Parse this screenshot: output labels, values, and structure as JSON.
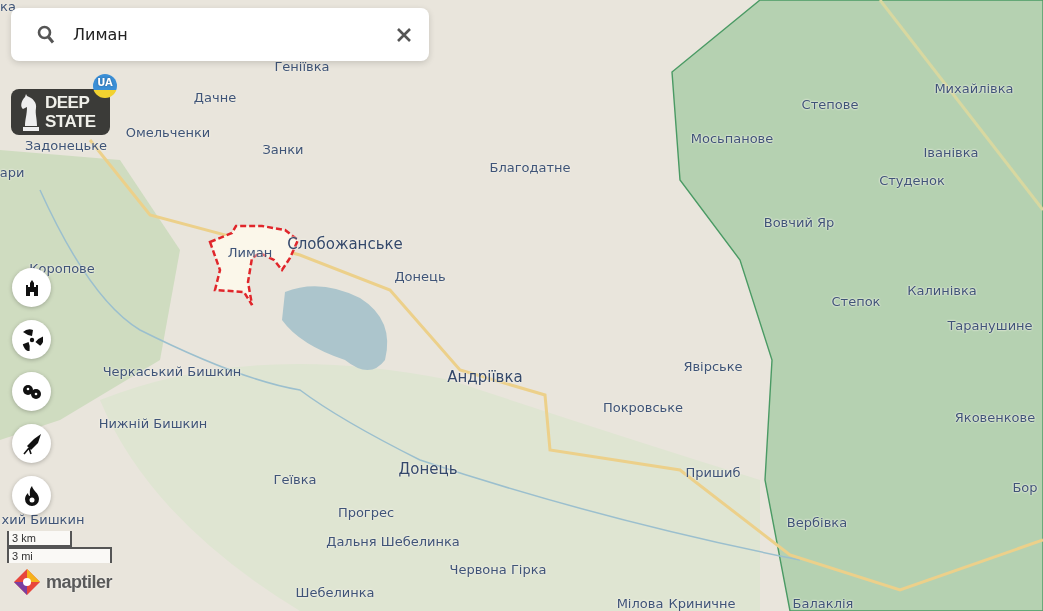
{
  "search": {
    "value": "Лиман"
  },
  "logo": {
    "line1": "DEEP",
    "line2": "STATE",
    "badge": "UA"
  },
  "tools": [
    {
      "kind": "castle"
    },
    {
      "kind": "radiation"
    },
    {
      "kind": "germs"
    },
    {
      "kind": "rocket"
    },
    {
      "kind": "fire"
    }
  ],
  "places": [
    {
      "name": "ка",
      "kind": "village"
    },
    {
      "name": "Геніївка",
      "kind": "village"
    },
    {
      "name": "Дачне",
      "kind": "village"
    },
    {
      "name": "Задонецьке",
      "kind": "village"
    },
    {
      "name": "Омельченки",
      "kind": "village"
    },
    {
      "name": "Занки",
      "kind": "village"
    },
    {
      "name": "ари",
      "kind": "village"
    },
    {
      "name": "Благодатне",
      "kind": "village"
    },
    {
      "name": "Мосьпанове",
      "kind": "village"
    },
    {
      "name": "Степове",
      "kind": "village"
    },
    {
      "name": "Михайлівка",
      "kind": "village"
    },
    {
      "name": "Іванівка",
      "kind": "village"
    },
    {
      "name": "Студенок",
      "kind": "village"
    },
    {
      "name": "Вовчий Яр",
      "kind": "village"
    },
    {
      "name": "Лиман",
      "kind": "village"
    },
    {
      "name": "Слобожанське",
      "kind": "town"
    },
    {
      "name": "Донець",
      "kind": "village"
    },
    {
      "name": "Коропове",
      "kind": "village"
    },
    {
      "name": "Степок",
      "kind": "village"
    },
    {
      "name": "Калинівка",
      "kind": "village"
    },
    {
      "name": "Таранушине",
      "kind": "village"
    },
    {
      "name": "Черкаський Бишкин",
      "kind": "village"
    },
    {
      "name": "Андріївка",
      "kind": "town"
    },
    {
      "name": "Явірське",
      "kind": "village"
    },
    {
      "name": "Покровське",
      "kind": "village"
    },
    {
      "name": "Яковенкове",
      "kind": "village"
    },
    {
      "name": "Нижній Бишкин",
      "kind": "village"
    },
    {
      "name": "Донець",
      "kind": "town"
    },
    {
      "name": "Геївка",
      "kind": "village"
    },
    {
      "name": "Пришиб",
      "kind": "village"
    },
    {
      "name": "Бор",
      "kind": "village"
    },
    {
      "name": "Прогрес",
      "kind": "village"
    },
    {
      "name": "Вербівка",
      "kind": "village"
    },
    {
      "name": "хий Бишкин",
      "kind": "village"
    },
    {
      "name": "Дальня Шебелинка",
      "kind": "village"
    },
    {
      "name": "Червона Гірка",
      "kind": "village"
    },
    {
      "name": "Шебелинка",
      "kind": "village"
    },
    {
      "name": "Мілова",
      "kind": "village"
    },
    {
      "name": "Криничне",
      "kind": "village"
    },
    {
      "name": "Балаклія",
      "kind": "village"
    }
  ],
  "scale": {
    "metric": "3 km",
    "imperial": "3 mi"
  },
  "attribution": "maptiler"
}
